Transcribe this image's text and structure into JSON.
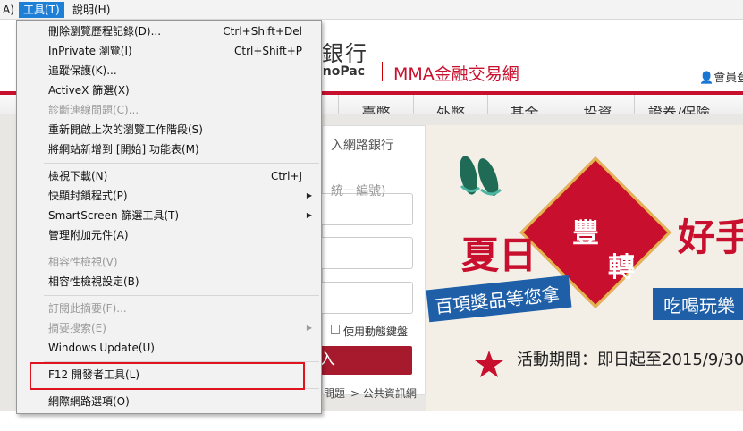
{
  "menubar": {
    "items": [
      {
        "label": "A)"
      },
      {
        "label": "工具(T)"
      },
      {
        "label": "說明(H)"
      }
    ]
  },
  "bank_page": {
    "bank_name": "銀行",
    "bank_name_en": "inoPac",
    "site_title": "MMA金融交易網",
    "member_link": "會員登",
    "nav": [
      "臺幣",
      "外幣",
      "基金",
      "投資",
      "證券/保險"
    ],
    "login": {
      "title": "入網路銀行",
      "id_placeholder": "統一編號)",
      "dynamic_keyboard": "使用動態鍵盤",
      "button": "入",
      "faq_link": "問題",
      "public_link": "> 公共資訊網"
    },
    "promo": {
      "word_1": "夏日",
      "char_1": "豐",
      "char_2": "轉",
      "word_2": "好手",
      "ribbon_left": "百項獎品等您拿",
      "ribbon_right": "吃喝玩樂",
      "period": "活動期間：即日起至2015/9/30"
    },
    "colors": {
      "brand_red": "#c8102e",
      "ribbon_blue": "#1f5fa8"
    }
  },
  "tools_menu": {
    "items": [
      {
        "label": "刪除瀏覽歷程記錄(D)...",
        "shortcut": "Ctrl+Shift+Del",
        "disabled": false
      },
      {
        "label": "InPrivate 瀏覽(I)",
        "shortcut": "Ctrl+Shift+P",
        "disabled": false
      },
      {
        "label": "追蹤保護(K)...",
        "shortcut": "",
        "disabled": false
      },
      {
        "label": "ActiveX 篩選(X)",
        "shortcut": "",
        "disabled": false
      },
      {
        "label": "診斷連線問題(C)...",
        "shortcut": "",
        "disabled": true
      },
      {
        "label": "重新開啟上次的瀏覽工作階段(S)",
        "shortcut": "",
        "disabled": false
      },
      {
        "label": "將網站新增到 [開始] 功能表(M)",
        "shortcut": "",
        "disabled": false
      },
      {
        "label": "檢視下載(N)",
        "shortcut": "Ctrl+J",
        "disabled": false
      },
      {
        "label": "快顯封鎖程式(P)",
        "shortcut": "",
        "disabled": false,
        "submenu": true
      },
      {
        "label": "SmartScreen 篩選工具(T)",
        "shortcut": "",
        "disabled": false,
        "submenu": true
      },
      {
        "label": "管理附加元件(A)",
        "shortcut": "",
        "disabled": false
      },
      {
        "label": "相容性檢視(V)",
        "shortcut": "",
        "disabled": true
      },
      {
        "label": "相容性檢視設定(B)",
        "shortcut": "",
        "disabled": false
      },
      {
        "label": "訂閱此摘要(F)...",
        "shortcut": "",
        "disabled": true
      },
      {
        "label": "摘要搜索(E)",
        "shortcut": "",
        "disabled": true,
        "submenu": true
      },
      {
        "label": "Windows Update(U)",
        "shortcut": "",
        "disabled": false
      },
      {
        "label": "F12 開發者工具(L)",
        "shortcut": "",
        "disabled": false,
        "highlighted": true
      },
      {
        "label": "網際網路選項(O)",
        "shortcut": "",
        "disabled": false
      }
    ],
    "highlight_color": "#e0141e"
  }
}
